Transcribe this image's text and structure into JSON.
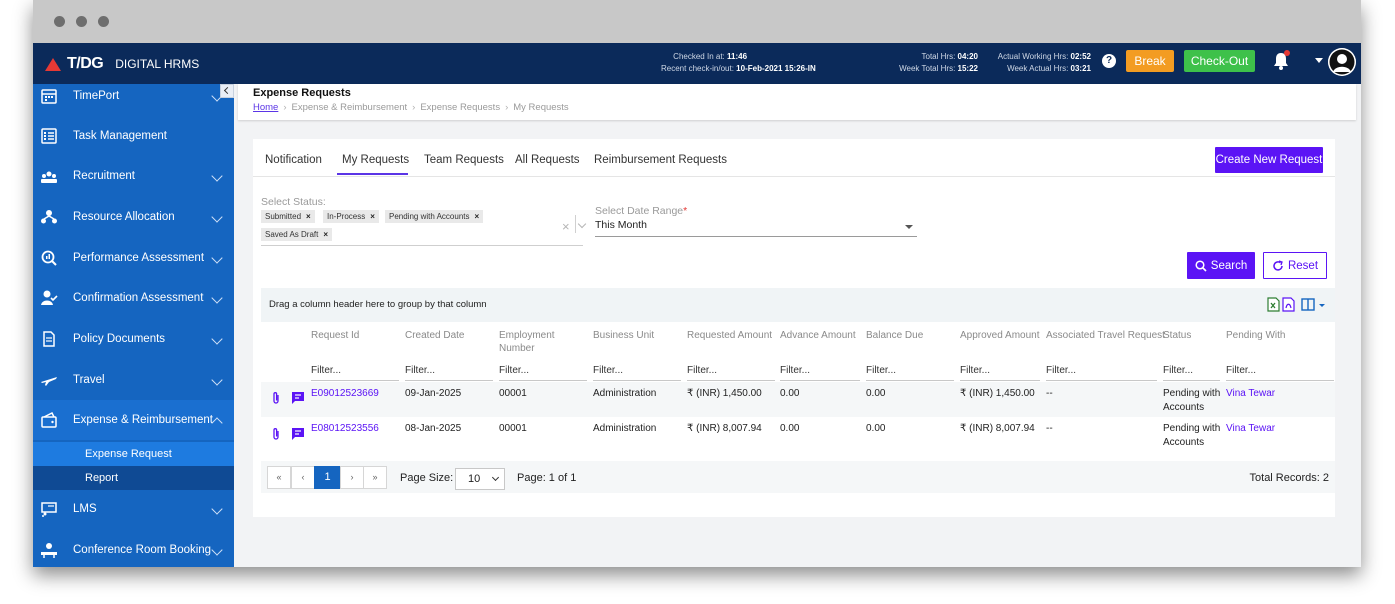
{
  "app": {
    "brand_mark": "T/DG",
    "brand_name": "DIGITAL HRMS"
  },
  "topbar": {
    "checked_in_label": "Checked In at:",
    "checked_in_value": "11:46",
    "recent_label": "Recent check-in/out:",
    "recent_value": "10-Feb-2021 15:26-IN",
    "total_hrs_label": "Total Hrs:",
    "total_hrs_value": "04:20",
    "week_total_label": "Week Total Hrs:",
    "week_total_value": "15:22",
    "actual_working_label": "Actual Working Hrs:",
    "actual_working_value": "02:52",
    "week_actual_label": "Week Actual Hrs:",
    "week_actual_value": "03:21",
    "help": "?",
    "break_label": "Break",
    "checkout_label": "Check-Out",
    "colors": {
      "break": "#f39c22",
      "checkout": "#3ec14a",
      "bar": "#0b2a5a"
    }
  },
  "sidebar": {
    "items": [
      {
        "label": "TimePort",
        "icon": "calendar-icon"
      },
      {
        "label": "Task Management",
        "icon": "checklist-icon"
      },
      {
        "label": "Recruitment",
        "icon": "people-icon"
      },
      {
        "label": "Resource Allocation",
        "icon": "network-icon"
      },
      {
        "label": "Performance Assessment",
        "icon": "search-chart-icon"
      },
      {
        "label": "Confirmation Assessment",
        "icon": "user-check-icon"
      },
      {
        "label": "Policy Documents",
        "icon": "document-icon"
      },
      {
        "label": "Travel",
        "icon": "plane-icon"
      },
      {
        "label": "Expense & Reimbursement",
        "icon": "wallet-icon"
      },
      {
        "label": "LMS",
        "icon": "lms-icon"
      },
      {
        "label": "Conference Room Booking",
        "icon": "meeting-icon"
      }
    ],
    "sub_items": [
      "Expense Request",
      "Report"
    ]
  },
  "page": {
    "title": "Expense Requests",
    "breadcrumb": [
      "Home",
      "Expense & Reimbursement",
      "Expense Requests",
      "My Requests"
    ]
  },
  "tabs": [
    "Notification",
    "My Requests",
    "Team Requests",
    "All Requests",
    "Reimbursement Requests"
  ],
  "create_button": "Create New Request",
  "filters": {
    "status_label": "Select Status:",
    "status_chips": [
      "Submitted",
      "In-Process",
      "Pending with Accounts",
      "Saved As Draft"
    ],
    "chip_remove": "×",
    "clear": "×",
    "date_label": "Select Date Range",
    "date_required": "*",
    "date_value": "This Month",
    "search_label": "Search",
    "reset_label": "Reset"
  },
  "grid": {
    "group_hint": "Drag a column header here to group by that column",
    "columns": [
      "Request Id",
      "Created Date",
      "Employment Number",
      "Business Unit",
      "Requested Amount",
      "Advance Amount",
      "Balance Due",
      "Approved Amount",
      "Associated Travel Request",
      "Status",
      "Pending With"
    ],
    "filter_placeholder": "Filter...",
    "rows": [
      {
        "request_id": "E09012523669",
        "created": "09-Jan-2025",
        "emp": "00001",
        "unit": "Administration",
        "requested": "₹ (INR) 1,450.00",
        "advance": "0.00",
        "balance": "0.00",
        "approved": "₹ (INR) 1,450.00",
        "travel": "--",
        "status": "Pending with Accounts",
        "pending_with": "Vina Tewar"
      },
      {
        "request_id": "E08012523556",
        "created": "08-Jan-2025",
        "emp": "00001",
        "unit": "Administration",
        "requested": "₹ (INR) 8,007.94",
        "advance": "0.00",
        "balance": "0.00",
        "approved": "₹ (INR) 8,007.94",
        "travel": "--",
        "status": "Pending with Accounts",
        "pending_with": "Vina Tewar"
      }
    ]
  },
  "pager": {
    "first": "«",
    "prev": "‹",
    "current": "1",
    "next": "›",
    "last": "»",
    "page_size_label": "Page Size:",
    "page_size": "10",
    "page_info": "Page: 1 of 1",
    "total": "Total Records: 2"
  }
}
